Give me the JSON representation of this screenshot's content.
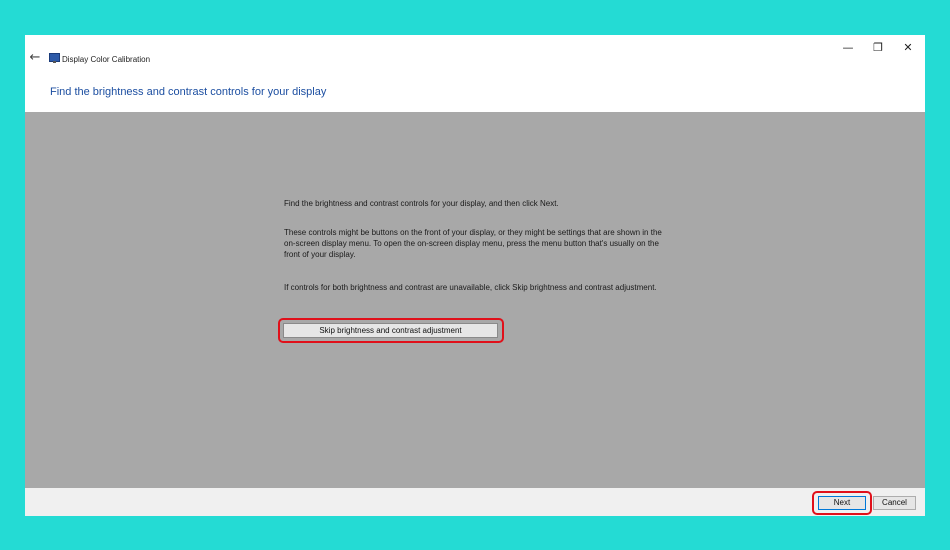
{
  "window": {
    "title": "Display Color Calibration",
    "controls": {
      "minimize": "—",
      "restore": "❐",
      "close": "✕"
    },
    "back": "←"
  },
  "heading": "Find the brightness and contrast controls for your display",
  "body": {
    "para1": "Find the brightness and contrast controls for your display, and then click Next.",
    "para2": "These controls might be buttons on the front of your display, or they might be settings that are shown in the on-screen display menu. To open the on-screen display menu, press the menu button that's usually on the front of your display.",
    "para3": "If controls for both brightness and contrast are unavailable, click Skip brightness and contrast adjustment.",
    "skip_button": "Skip brightness and contrast adjustment"
  },
  "footer": {
    "next_label": "Next",
    "cancel_label": "Cancel"
  },
  "colors": {
    "background": "#24dbd4",
    "content_gray": "#a8a8a8",
    "heading_blue": "#1d4fa1",
    "highlight_red": "#e0101a"
  },
  "icons": {
    "back": "back-arrow-icon",
    "app": "display-monitor-icon"
  }
}
